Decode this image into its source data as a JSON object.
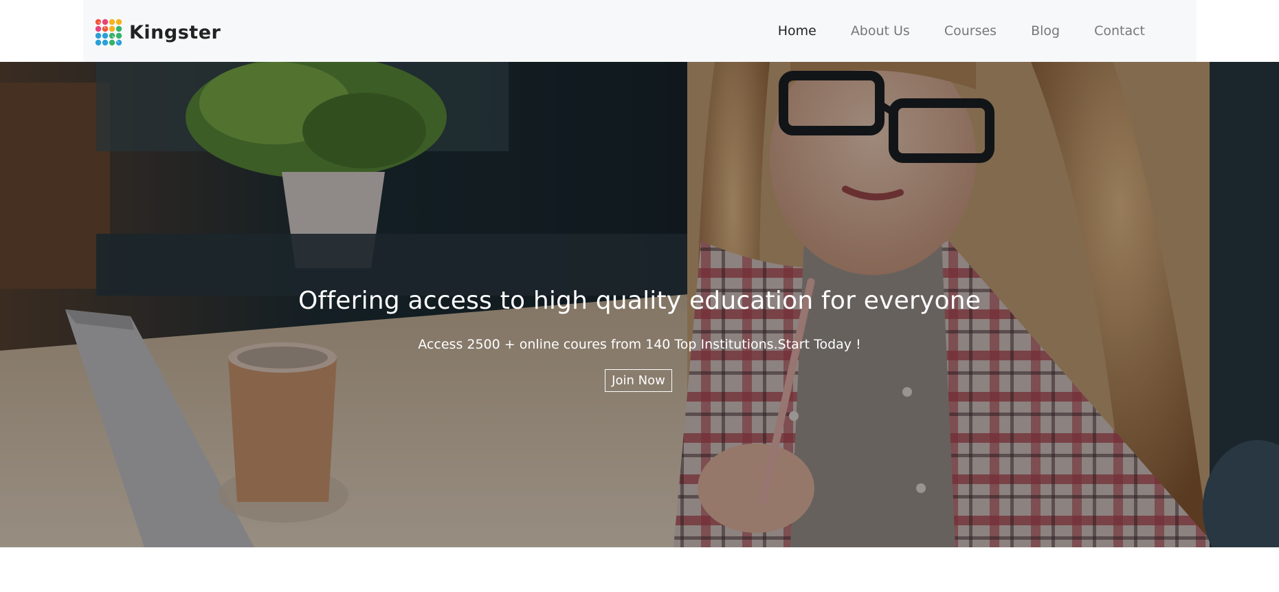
{
  "brand": {
    "name": "Kingster",
    "logo_icon": "kingster-logo-icon",
    "logo_colors": [
      "#f0553a",
      "#f7b21c",
      "#2b9fd8",
      "#34b36b",
      "#e8427c"
    ]
  },
  "nav": {
    "items": [
      {
        "label": "Home",
        "active": true
      },
      {
        "label": "About Us",
        "active": false
      },
      {
        "label": "Courses",
        "active": false
      },
      {
        "label": "Blog",
        "active": false
      },
      {
        "label": "Contact",
        "active": false
      }
    ]
  },
  "hero": {
    "title": "Offering access to high quality education for everyone",
    "subtitle": "Access 2500 + online coures from 140 Top Institutions.Start Today !",
    "cta_label": "Join Now",
    "background_image": "student-writing-photo"
  },
  "colors": {
    "navbar_bg": "#f7f8fa",
    "nav_active": "#222222",
    "nav_inactive": "#777777",
    "hero_text": "#ffffff"
  }
}
